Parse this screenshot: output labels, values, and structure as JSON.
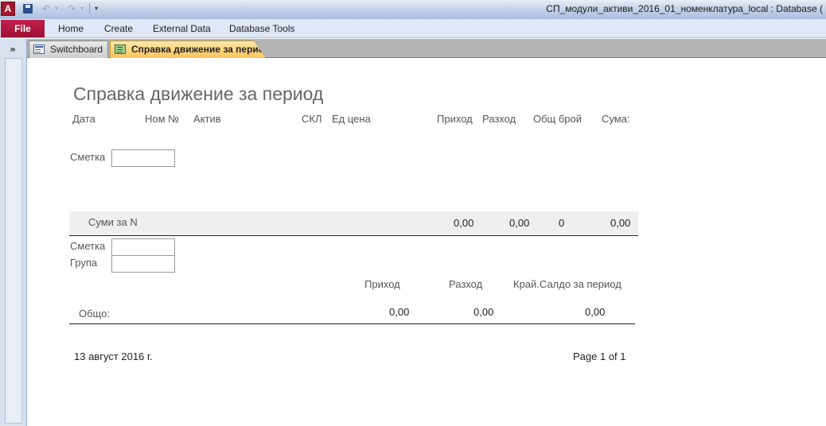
{
  "titlebar": {
    "app_icon": "A",
    "save_icon": "save-icon",
    "undo_icon": "↶",
    "redo_icon": "↷",
    "dropdown_icon": "▾",
    "customize_icon": "▾",
    "window_title": "СП_модули_активи_2016_01_номенклатура_local : Database ("
  },
  "ribbon": {
    "file": "File",
    "tabs": [
      "Home",
      "Create",
      "External Data",
      "Database Tools"
    ]
  },
  "nav": {
    "toggle": "»"
  },
  "doc_tabs": [
    {
      "label": "Switchboard",
      "icon": "form-icon",
      "active": false
    },
    {
      "label": "Справка движение за период",
      "icon": "report-icon",
      "active": true
    }
  ],
  "report": {
    "title": "Справка движение за период",
    "columns": [
      "Дата",
      "Ном №",
      "Актив",
      "СКЛ",
      "Ед цена",
      "Приход",
      "Разход",
      "Общ брой",
      "Сума:"
    ],
    "smetka_label": "Сметка",
    "group_totals": {
      "label": "Суми за N",
      "prihod": "0,00",
      "razhod": "0,00",
      "broi": "0",
      "suma": "0,00"
    },
    "footer_smetka_label": "Сметка",
    "footer_grupa_label": "Група",
    "summary_headers": [
      "Приход",
      "Разход",
      "Край.Салдо за период"
    ],
    "total": {
      "label": "Общо:",
      "prihod": "0,00",
      "razhod": "0,00",
      "saldo": "0,00"
    },
    "date": "13 август 2016 г.",
    "page": "Page 1 of 1"
  },
  "colors": {
    "file_tab": "#b0173f",
    "active_tab": "#fcc45c",
    "band": "#efefef"
  }
}
